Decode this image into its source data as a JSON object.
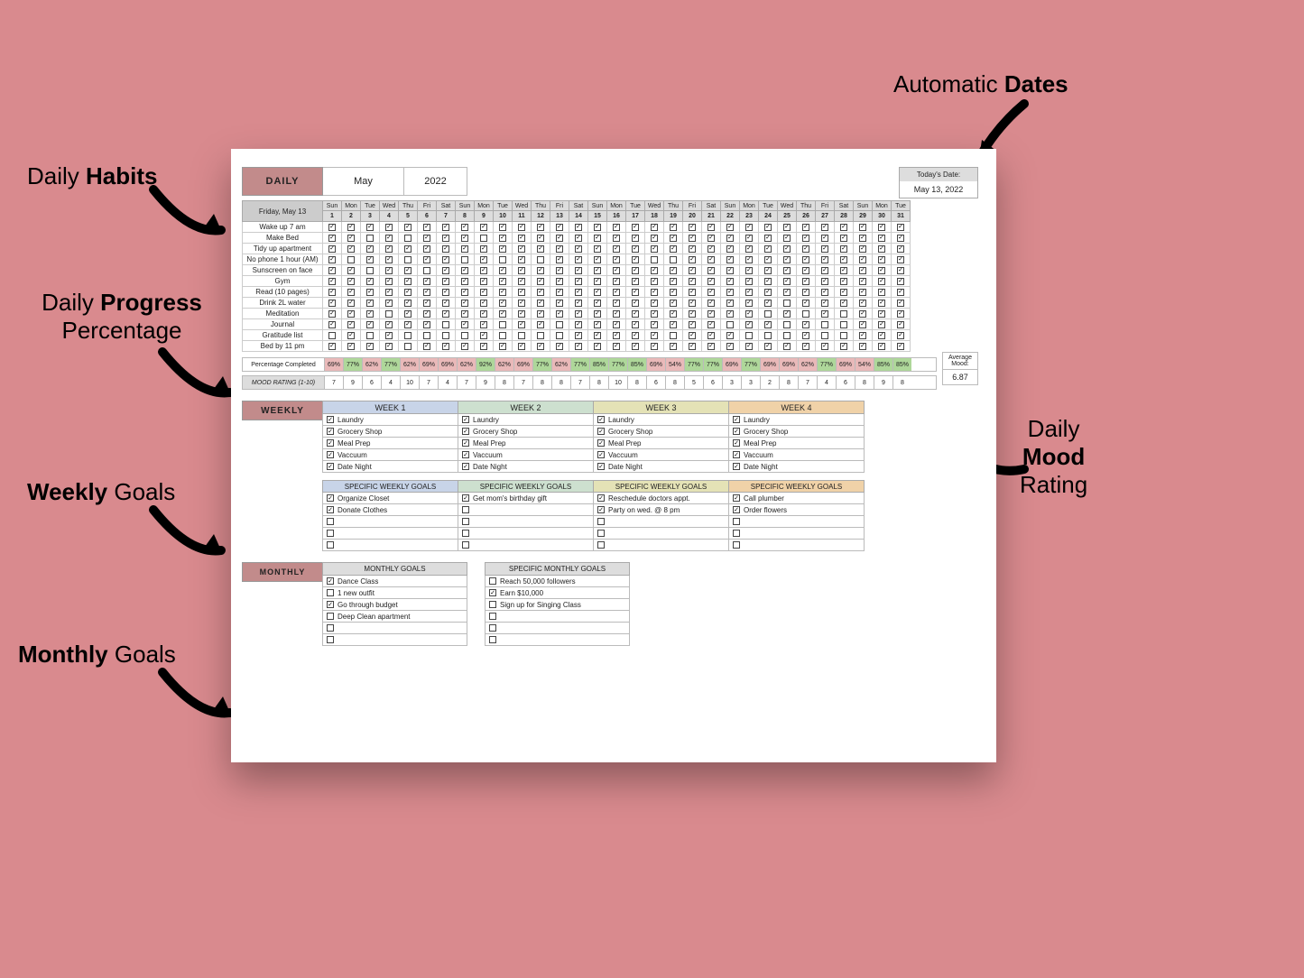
{
  "callouts": {
    "daily_habits_pre": "Daily ",
    "daily_habits_b": "Habits",
    "progress_pre": "Daily ",
    "progress_b": "Progress",
    "progress_post": "Percentage",
    "weekly_b": "Weekly",
    "weekly_post": " Goals",
    "monthly_b": "Monthly",
    "monthly_post": " Goals",
    "dates_pre": "Automatic ",
    "dates_b": "Dates",
    "mood_pre": "Daily",
    "mood_b": "Mood",
    "mood_post": "Rating"
  },
  "header": {
    "daily_label": "DAILY",
    "month": "May",
    "year": "2022",
    "today_label": "Today's Date:",
    "today_value": "May 13, 2022",
    "date_header": "Friday, May 13"
  },
  "dow": [
    "Sun",
    "Mon",
    "Tue",
    "Wed",
    "Thu",
    "Fri",
    "Sat",
    "Sun",
    "Mon",
    "Tue",
    "Wed",
    "Thu",
    "Fri",
    "Sat",
    "Sun",
    "Mon",
    "Tue",
    "Wed",
    "Thu",
    "Fri",
    "Sat",
    "Sun",
    "Mon",
    "Tue",
    "Wed",
    "Thu",
    "Fri",
    "Sat",
    "Sun",
    "Mon",
    "Tue"
  ],
  "days": [
    1,
    2,
    3,
    4,
    5,
    6,
    7,
    8,
    9,
    10,
    11,
    12,
    13,
    14,
    15,
    16,
    17,
    18,
    19,
    20,
    21,
    22,
    23,
    24,
    25,
    26,
    27,
    28,
    29,
    30,
    31
  ],
  "habits": [
    {
      "name": "Wake up 7 am",
      "checks": [
        1,
        1,
        1,
        1,
        1,
        1,
        1,
        1,
        1,
        1,
        1,
        1,
        1,
        1,
        1,
        1,
        1,
        1,
        1,
        1,
        1,
        1,
        1,
        1,
        1,
        1,
        1,
        1,
        1,
        1,
        1
      ]
    },
    {
      "name": "Make Bed",
      "checks": [
        1,
        1,
        0,
        1,
        0,
        1,
        1,
        1,
        0,
        1,
        1,
        1,
        1,
        1,
        1,
        1,
        1,
        1,
        1,
        1,
        1,
        1,
        1,
        1,
        1,
        1,
        1,
        1,
        1,
        1,
        1
      ]
    },
    {
      "name": "Tidy up apartment",
      "checks": [
        1,
        1,
        1,
        1,
        1,
        1,
        1,
        1,
        1,
        1,
        1,
        1,
        1,
        1,
        1,
        1,
        1,
        1,
        1,
        1,
        1,
        1,
        1,
        1,
        1,
        1,
        1,
        1,
        1,
        1,
        1
      ]
    },
    {
      "name": "No phone 1 hour (AM)",
      "checks": [
        1,
        0,
        1,
        1,
        0,
        1,
        1,
        0,
        1,
        0,
        1,
        0,
        1,
        1,
        1,
        1,
        1,
        0,
        0,
        1,
        1,
        1,
        1,
        1,
        1,
        1,
        1,
        1,
        1,
        1,
        1
      ]
    },
    {
      "name": "Sunscreen on face",
      "checks": [
        1,
        1,
        0,
        1,
        1,
        0,
        1,
        1,
        1,
        1,
        1,
        1,
        1,
        1,
        1,
        1,
        1,
        1,
        1,
        1,
        1,
        1,
        1,
        1,
        1,
        1,
        1,
        1,
        1,
        1,
        1
      ]
    },
    {
      "name": "Gym",
      "checks": [
        1,
        1,
        1,
        1,
        1,
        1,
        1,
        1,
        1,
        1,
        1,
        1,
        1,
        1,
        1,
        1,
        1,
        1,
        1,
        1,
        1,
        1,
        1,
        1,
        1,
        1,
        1,
        1,
        1,
        1,
        1
      ]
    },
    {
      "name": "Read (10 pages)",
      "checks": [
        1,
        1,
        1,
        1,
        1,
        1,
        1,
        1,
        1,
        1,
        1,
        1,
        1,
        1,
        1,
        1,
        1,
        1,
        1,
        1,
        1,
        1,
        1,
        1,
        1,
        1,
        1,
        1,
        1,
        1,
        1
      ]
    },
    {
      "name": "Drink 2L water",
      "checks": [
        1,
        1,
        1,
        1,
        1,
        1,
        1,
        1,
        1,
        1,
        1,
        1,
        1,
        1,
        1,
        1,
        1,
        1,
        1,
        1,
        1,
        1,
        1,
        1,
        0,
        1,
        1,
        1,
        1,
        1,
        1
      ]
    },
    {
      "name": "Meditation",
      "checks": [
        1,
        1,
        1,
        0,
        1,
        1,
        1,
        1,
        1,
        1,
        1,
        1,
        1,
        1,
        1,
        1,
        1,
        1,
        1,
        1,
        1,
        1,
        1,
        0,
        1,
        0,
        1,
        0,
        1,
        1,
        1
      ]
    },
    {
      "name": "Journal",
      "checks": [
        1,
        1,
        1,
        1,
        1,
        1,
        0,
        1,
        1,
        0,
        1,
        1,
        0,
        1,
        1,
        1,
        1,
        1,
        1,
        1,
        1,
        0,
        1,
        1,
        0,
        1,
        0,
        0,
        1,
        1,
        1
      ]
    },
    {
      "name": "Gratitude list",
      "checks": [
        0,
        1,
        0,
        1,
        0,
        0,
        0,
        0,
        1,
        0,
        0,
        0,
        0,
        1,
        1,
        1,
        1,
        1,
        0,
        1,
        1,
        1,
        0,
        0,
        0,
        1,
        0,
        0,
        1,
        1,
        1
      ]
    },
    {
      "name": "Bed by 11 pm",
      "checks": [
        1,
        1,
        1,
        1,
        0,
        1,
        1,
        1,
        1,
        1,
        1,
        1,
        1,
        1,
        1,
        1,
        1,
        1,
        1,
        1,
        1,
        1,
        1,
        1,
        1,
        1,
        1,
        1,
        1,
        1,
        1
      ]
    }
  ],
  "pct": {
    "label": "Percentage Completed",
    "values": [
      "69%",
      "77%",
      "62%",
      "77%",
      "62%",
      "69%",
      "69%",
      "62%",
      "92%",
      "62%",
      "69%",
      "77%",
      "62%",
      "77%",
      "85%",
      "77%",
      "85%",
      "69%",
      "54%",
      "77%",
      "77%",
      "69%",
      "77%",
      "69%",
      "69%",
      "62%",
      "77%",
      "69%",
      "54%",
      "85%",
      "85%"
    ],
    "colors": [
      "p",
      "g",
      "p",
      "g",
      "p",
      "p",
      "p",
      "p",
      "g",
      "p",
      "p",
      "g",
      "p",
      "g",
      "g",
      "g",
      "g",
      "p",
      "p",
      "g",
      "g",
      "p",
      "g",
      "p",
      "p",
      "p",
      "g",
      "p",
      "p",
      "g",
      "g"
    ]
  },
  "mood": {
    "label": "MOOD RATING (1-10)",
    "values": [
      7,
      9,
      6,
      4,
      10,
      7,
      4,
      7,
      9,
      8,
      7,
      8,
      8,
      7,
      8,
      10,
      8,
      6,
      8,
      5,
      6,
      3,
      3,
      2,
      8,
      7,
      4,
      6,
      8,
      9,
      8
    ],
    "avg_label": "Average Mood:",
    "avg_value": "6.87"
  },
  "weekly": {
    "label": "WEEKLY",
    "common_items": [
      "Laundry",
      "Grocery Shop",
      "Meal Prep",
      "Vaccuum",
      "Date Night"
    ],
    "weeks": [
      {
        "title": "WEEK 1",
        "goals_title": "SPECIFIC WEEKLY GOALS",
        "goals": [
          {
            "t": "Organize Closet",
            "c": 1
          },
          {
            "t": "Donate Clothes",
            "c": 1
          },
          {
            "t": "",
            "c": 0
          },
          {
            "t": "",
            "c": 0
          },
          {
            "t": "",
            "c": 0
          }
        ]
      },
      {
        "title": "WEEK 2",
        "goals_title": "SPECIFIC WEEKLY GOALS",
        "goals": [
          {
            "t": "Get mom's birthday gift",
            "c": 1
          },
          {
            "t": "",
            "c": 0
          },
          {
            "t": "",
            "c": 0
          },
          {
            "t": "",
            "c": 0
          },
          {
            "t": "",
            "c": 0
          }
        ]
      },
      {
        "title": "WEEK 3",
        "goals_title": "SPECIFIC WEEKLY GOALS",
        "goals": [
          {
            "t": "Reschedule doctors appt.",
            "c": 1
          },
          {
            "t": "Party on wed. @ 8 pm",
            "c": 1
          },
          {
            "t": "",
            "c": 0
          },
          {
            "t": "",
            "c": 0
          },
          {
            "t": "",
            "c": 0
          }
        ]
      },
      {
        "title": "WEEK 4",
        "goals_title": "SPECIFIC WEEKLY GOALS",
        "goals": [
          {
            "t": "Call plumber",
            "c": 1
          },
          {
            "t": "Order flowers",
            "c": 1
          },
          {
            "t": "",
            "c": 0
          },
          {
            "t": "",
            "c": 0
          },
          {
            "t": "",
            "c": 0
          }
        ]
      }
    ]
  },
  "monthly": {
    "label": "MONTHLY",
    "goals_title": "MONTHLY GOALS",
    "goals": [
      {
        "t": "Dance Class",
        "c": 1
      },
      {
        "t": "1 new outfit",
        "c": 0
      },
      {
        "t": "Go through budget",
        "c": 1
      },
      {
        "t": "Deep Clean apartment",
        "c": 0
      },
      {
        "t": "",
        "c": 0
      },
      {
        "t": "",
        "c": 0
      }
    ],
    "specific_title": "SPECIFIC MONTHLY GOALS",
    "specific": [
      {
        "t": "Reach 50,000 followers",
        "c": 0
      },
      {
        "t": "Earn $10,000",
        "c": 1
      },
      {
        "t": "Sign up for Singing Class",
        "c": 0
      },
      {
        "t": "",
        "c": 0
      },
      {
        "t": "",
        "c": 0
      },
      {
        "t": "",
        "c": 0
      }
    ]
  }
}
